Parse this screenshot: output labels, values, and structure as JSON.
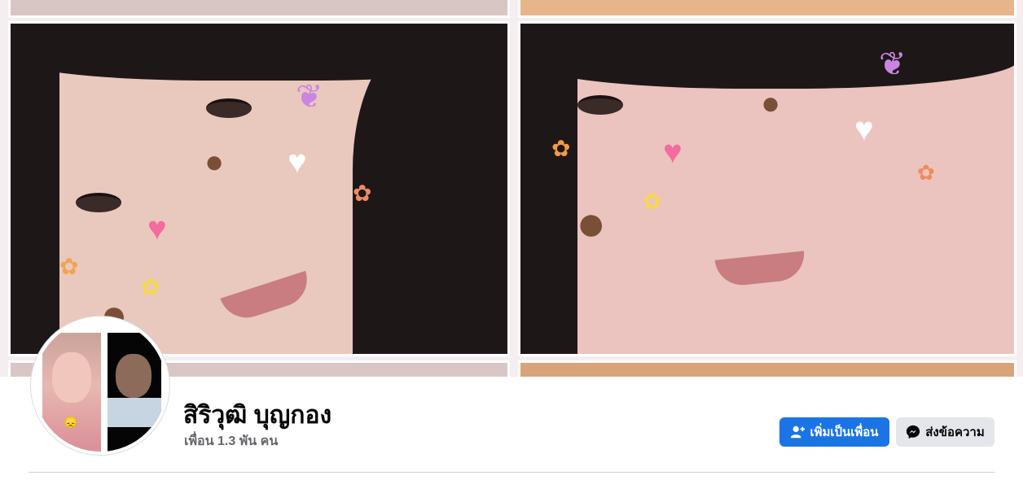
{
  "profile": {
    "name": "สิริวุฒิ บุญกอง",
    "friends_count": "เพื่อน 1.3 พัน คน"
  },
  "actions": {
    "add_friend_label": "เพิ่มเป็นเพื่อน",
    "add_friend_icon": "add-friend-icon",
    "message_label": "ส่งข้อความ",
    "message_icon": "messenger-icon"
  },
  "colors": {
    "primary_button": "#1b74e4",
    "secondary_button": "#e4e6eb",
    "name_text": "#050505",
    "muted_text": "#65676b"
  }
}
